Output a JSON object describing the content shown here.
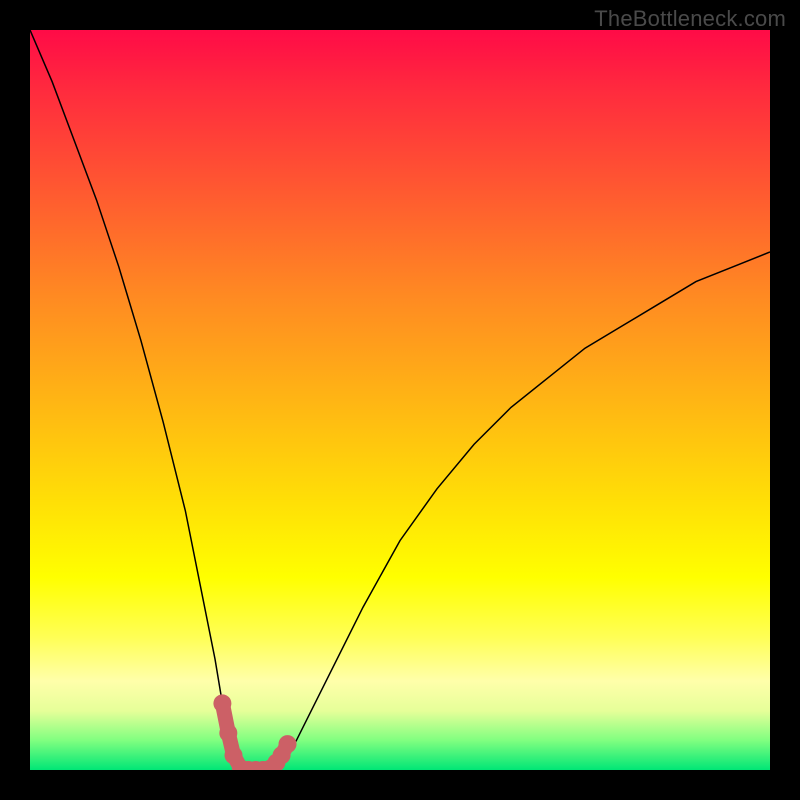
{
  "watermark": "TheBottleneck.com",
  "chart_data": {
    "type": "line",
    "title": "",
    "xlabel": "",
    "ylabel": "",
    "xlim": [
      0,
      100
    ],
    "ylim": [
      0,
      100
    ],
    "series": [
      {
        "name": "bottleneck-curve",
        "x": [
          0,
          3,
          6,
          9,
          12,
          15,
          18,
          21,
          23,
          25,
          26,
          27,
          28,
          29,
          30,
          31,
          32,
          33,
          34,
          36,
          40,
          45,
          50,
          55,
          60,
          65,
          70,
          75,
          80,
          85,
          90,
          95,
          100
        ],
        "y": [
          100,
          93,
          85,
          77,
          68,
          58,
          47,
          35,
          25,
          15,
          9,
          5,
          2,
          0,
          0,
          0,
          0,
          0,
          1,
          4,
          12,
          22,
          31,
          38,
          44,
          49,
          53,
          57,
          60,
          63,
          66,
          68,
          70
        ]
      }
    ],
    "markers": {
      "name": "highlighted-points",
      "x": [
        26.0,
        26.8,
        27.5,
        28.5,
        29.5,
        30.5,
        31.5,
        32.5,
        33.3,
        34.0,
        34.8
      ],
      "y": [
        9.0,
        5.0,
        2.0,
        0.2,
        0.0,
        0.0,
        0.0,
        0.2,
        1.0,
        2.0,
        3.5
      ],
      "color": "#cc6066"
    },
    "background": {
      "type": "vertical-gradient",
      "meaning": "red (top) = high bottleneck, green (bottom) = no bottleneck",
      "stops": [
        {
          "pos": 0.0,
          "color": "#ff0b47"
        },
        {
          "pos": 0.5,
          "color": "#ffb514"
        },
        {
          "pos": 0.74,
          "color": "#ffff00"
        },
        {
          "pos": 1.0,
          "color": "#00e676"
        }
      ]
    }
  }
}
